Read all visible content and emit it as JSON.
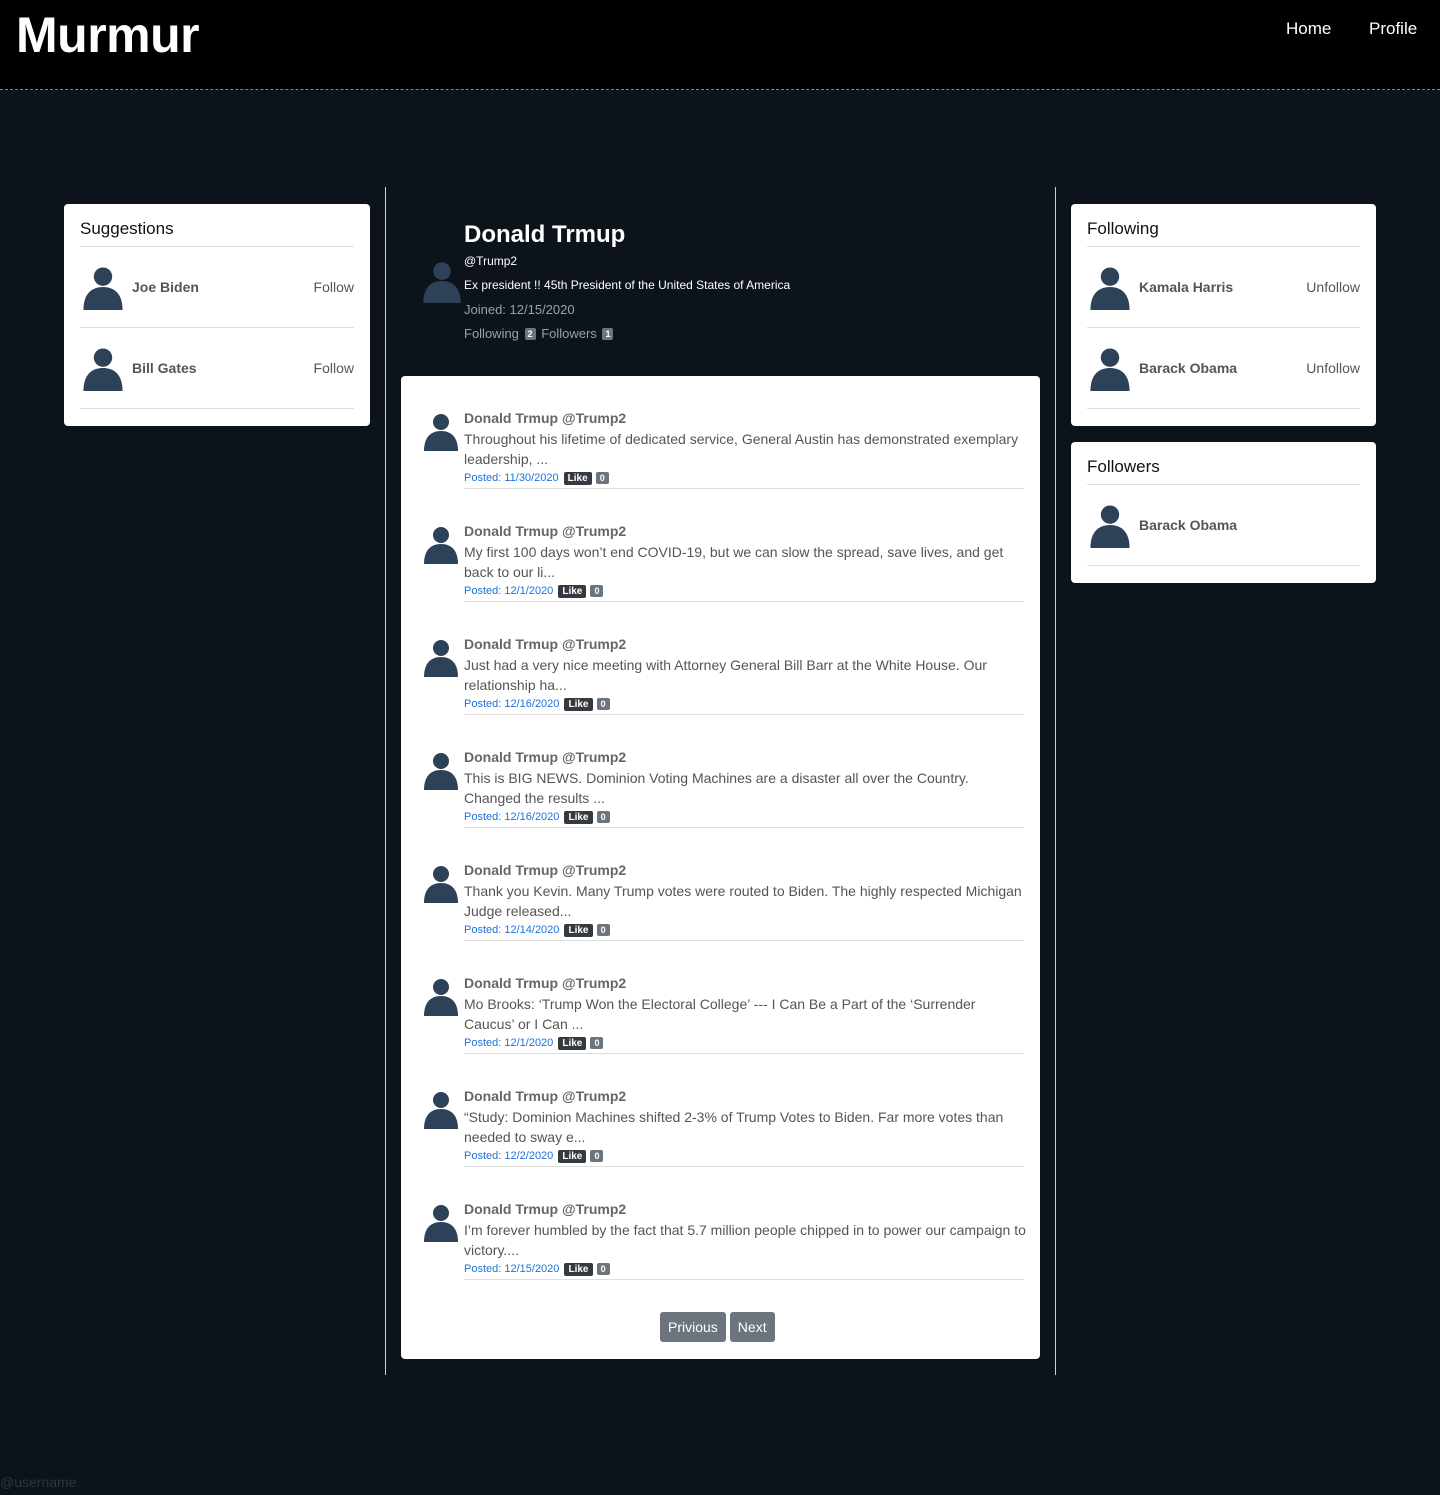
{
  "nav": {
    "brand": "Murmur",
    "home": "Home",
    "profile": "Profile"
  },
  "suggestions": {
    "title": "Suggestions",
    "users": [
      {
        "name": "Joe Biden",
        "action": "Follow"
      },
      {
        "name": "Bill Gates",
        "action": "Follow"
      }
    ]
  },
  "following": {
    "title": "Following",
    "users": [
      {
        "name": "Kamala Harris",
        "action": "Unfollow"
      },
      {
        "name": "Barack Obama",
        "action": "Unfollow"
      }
    ]
  },
  "followers": {
    "title": "Followers",
    "users": [
      {
        "name": "Barack Obama"
      }
    ]
  },
  "profile": {
    "name": "Donald Trmup",
    "handle": "@Trump2",
    "bio": "Ex president !! 45th President of the United States of America",
    "joined": "Joined: 12/15/2020",
    "following_label": "Following",
    "following_count": "2",
    "followers_label": "Followers",
    "followers_count": "1"
  },
  "posts": [
    {
      "author": "Donald Trmup @Trump2",
      "text": "Throughout his lifetime of dedicated service, General Austin has demonstrated exemplary leadership, ...",
      "posted": "Posted: 11/30/2020",
      "like": "Like",
      "likes": "0"
    },
    {
      "author": "Donald Trmup @Trump2",
      "text": "My first 100 days won’t end COVID-19, but we can slow the spread, save lives, and get back to our li...",
      "posted": "Posted: 12/1/2020",
      "like": "Like",
      "likes": "0"
    },
    {
      "author": "Donald Trmup @Trump2",
      "text": "Just had a very nice meeting with Attorney General Bill Barr at the White House. Our relationship ha...",
      "posted": "Posted: 12/16/2020",
      "like": "Like",
      "likes": "0"
    },
    {
      "author": "Donald Trmup @Trump2",
      "text": "This is BIG NEWS. Dominion Voting Machines are a disaster all over the Country. Changed the results ...",
      "posted": "Posted: 12/16/2020",
      "like": "Like",
      "likes": "0"
    },
    {
      "author": "Donald Trmup @Trump2",
      "text": "Thank you Kevin. Many Trump votes were routed to Biden. The highly respected Michigan Judge released...",
      "posted": "Posted: 12/14/2020",
      "like": "Like",
      "likes": "0"
    },
    {
      "author": "Donald Trmup @Trump2",
      "text": "Mo Brooks: ‘Trump Won the Electoral College’ --- I Can Be a Part of the ‘Surrender Caucus’ or I Can ...",
      "posted": "Posted: 12/1/2020",
      "like": "Like",
      "likes": "0"
    },
    {
      "author": "Donald Trmup @Trump2",
      "text": "“Study: Dominion Machines shifted 2-3% of Trump Votes to Biden. Far more votes than needed to sway e...",
      "posted": "Posted: 12/2/2020",
      "like": "Like",
      "likes": "0"
    },
    {
      "author": "Donald Trmup @Trump2",
      "text": "I’m forever humbled by the fact that 5.7 million people chipped in to power our campaign to victory....",
      "posted": "Posted: 12/15/2020",
      "like": "Like",
      "likes": "0"
    }
  ],
  "pager": {
    "previous": "Privious",
    "next": "Next"
  },
  "footer": {
    "username_placeholder": "@username"
  },
  "colors": {
    "background": "#0d131b",
    "navbar": "#000000",
    "avatar": "#2d4159",
    "link": "#1b72d9"
  },
  "icons": {
    "avatar": "user-silhouette-icon"
  }
}
